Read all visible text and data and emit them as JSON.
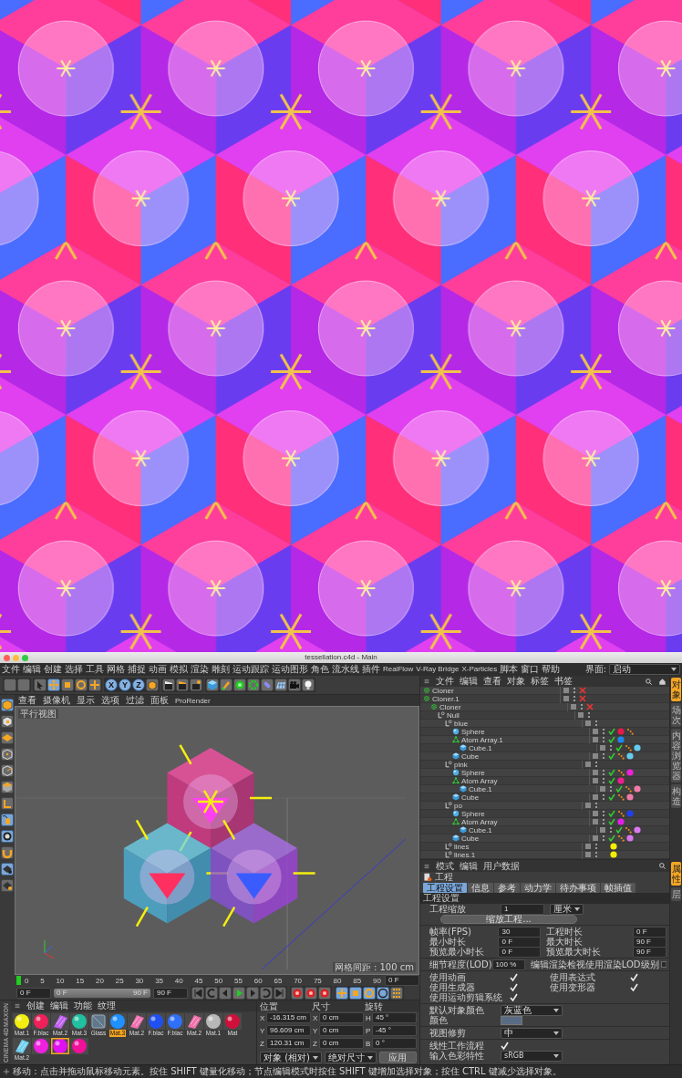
{
  "window": {
    "title": "tessellation.c4d - Main"
  },
  "menu_bar": {
    "items": [
      "文件",
      "编辑",
      "创建",
      "选择",
      "工具",
      "网格",
      "捕捉",
      "动画",
      "模拟",
      "渲染",
      "雕刻",
      "运动跟踪",
      "运动图形",
      "角色",
      "流水线",
      "插件",
      "RealFlow",
      "V-Ray Bridge",
      "X-Particles",
      "脚本",
      "窗口",
      "帮助"
    ],
    "layout_label": "界面:",
    "layout_value": "启动"
  },
  "toolbar": {
    "axis_buttons": [
      "X",
      "Y",
      "Z"
    ]
  },
  "viewport": {
    "menu": [
      "查看",
      "摄像机",
      "显示",
      "选项",
      "过滤",
      "面板",
      "ProRender"
    ],
    "view_name": "平行视图",
    "grid_spacing": "网格间距 : 100 cm"
  },
  "timeline": {
    "ticks": [
      "0",
      "5",
      "10",
      "15",
      "20",
      "25",
      "30",
      "35",
      "40",
      "45",
      "50",
      "55",
      "60",
      "65",
      "70",
      "75",
      "80",
      "85",
      "90"
    ],
    "current_frame": "0 F",
    "start_field": "0 F",
    "range": {
      "level": 1,
      "start": "0 F",
      "end": "90 F"
    },
    "end_field": "90 F"
  },
  "logo": {
    "brand": "MAXON",
    "product": "CINEMA 4D"
  },
  "materials": {
    "menu": [
      "创建",
      "编辑",
      "功能",
      "纹理"
    ],
    "items": [
      {
        "name": "Mat.1",
        "kind": "sphere",
        "color": "#f2ee10",
        "selected": false
      },
      {
        "name": "F.blac",
        "kind": "sphere",
        "color": "#f0205a",
        "selected": false
      },
      {
        "name": "Mat.2",
        "kind": "stripes",
        "color": "#c060f0",
        "selected": false
      },
      {
        "name": "Mat.3",
        "kind": "sphere",
        "color": "#20c0a0",
        "selected": false
      },
      {
        "name": "Glass",
        "kind": "glass",
        "color": "#60788a",
        "selected": false
      },
      {
        "name": "Mat.3",
        "kind": "sphere",
        "color": "#1e90ff",
        "selected": true
      },
      {
        "name": "Mat.2",
        "kind": "stripes",
        "color": "#f070b0",
        "selected": false
      },
      {
        "name": "F.blac",
        "kind": "sphere",
        "color": "#2050f0",
        "selected": false
      },
      {
        "name": "F.blac",
        "kind": "sphere",
        "color": "#3070f8",
        "selected": false
      },
      {
        "name": "Mat.2",
        "kind": "stripes",
        "color": "#f070a8",
        "selected": false
      },
      {
        "name": "Mat.1",
        "kind": "sphere",
        "color": "#b8b8b8",
        "selected": false
      },
      {
        "name": "Mat",
        "kind": "sphere",
        "color": "#d0103a",
        "selected": false
      },
      {
        "name": "Mat.2",
        "kind": "stripes",
        "color": "#70d0f0",
        "selected": false
      },
      {
        "kind": "sphere",
        "color": "#f020e0",
        "selected": false
      },
      {
        "kind": "sphere",
        "color": "#e010f0",
        "selected": true
      },
      {
        "kind": "sphere",
        "color": "#f0109a",
        "selected": false
      }
    ]
  },
  "coordinates": {
    "headers": [
      "位置",
      "尺寸",
      "旋转"
    ],
    "rows": [
      {
        "axis_1": "X",
        "position": "-16.315 cm",
        "axis_2": "X",
        "size": "0 cm",
        "axis_3": "H",
        "rotation": "45 °"
      },
      {
        "axis_1": "Y",
        "position": "96.609 cm",
        "axis_2": "Y",
        "size": "0 cm",
        "axis_3": "P",
        "rotation": "-45 °"
      },
      {
        "axis_1": "Z",
        "position": "120.31 cm",
        "axis_2": "Z",
        "size": "0 cm",
        "axis_3": "B",
        "rotation": "0 °"
      }
    ],
    "mode": "对象 (相对)",
    "size_mode": "绝对尺寸",
    "apply": "应用"
  },
  "object_manager": {
    "menu": [
      "文件",
      "编辑",
      "查看",
      "对象",
      "标签",
      "书签"
    ],
    "tree": [
      {
        "name": "Cloner",
        "kind": "cloner",
        "enabled": false
      },
      {
        "name": "Cloner.1",
        "kind": "cloner",
        "enabled": false,
        "children": [
          {
            "name": "Cloner",
            "kind": "cloner",
            "enabled": false,
            "children": [
              {
                "name": "Null",
                "kind": "null",
                "children": [
                  {
                    "name": "blue",
                    "kind": "null",
                    "children": [
                      {
                        "name": "Sphere",
                        "kind": "sphere",
                        "enabled": true,
                        "tags": [
                          {
                            "kind": "material",
                            "color": "#e8194b"
                          },
                          {
                            "kind": "dots"
                          }
                        ]
                      },
                      {
                        "name": "Atom Array.1",
                        "kind": "atom",
                        "enabled": true,
                        "tags": [
                          {
                            "kind": "material",
                            "color": "#1e88f0"
                          }
                        ],
                        "children": [
                          {
                            "name": "Cube.1",
                            "kind": "cube",
                            "enabled": true,
                            "tags": [
                              {
                                "kind": "dots"
                              },
                              {
                                "kind": "material",
                                "color": "#66ccee"
                              }
                            ]
                          }
                        ]
                      },
                      {
                        "name": "Cube",
                        "kind": "cube",
                        "enabled": true,
                        "tags": [
                          {
                            "kind": "dots"
                          },
                          {
                            "kind": "material",
                            "color": "#66ccee"
                          }
                        ]
                      }
                    ]
                  },
                  {
                    "name": "pink",
                    "kind": "null",
                    "children": [
                      {
                        "name": "Sphere",
                        "kind": "sphere",
                        "enabled": true,
                        "tags": [
                          {
                            "kind": "dots"
                          },
                          {
                            "kind": "material",
                            "color": "#f020d8"
                          }
                        ]
                      },
                      {
                        "name": "Atom Array",
                        "kind": "atom",
                        "enabled": true,
                        "tags": [
                          {
                            "kind": "material",
                            "color": "#f01e90"
                          }
                        ],
                        "children": [
                          {
                            "name": "Cube.1",
                            "kind": "cube",
                            "enabled": true,
                            "tags": [
                              {
                                "kind": "dots"
                              },
                              {
                                "kind": "material",
                                "color": "#f07aa8"
                              }
                            ]
                          }
                        ]
                      },
                      {
                        "name": "Cube",
                        "kind": "cube",
                        "enabled": true,
                        "tags": [
                          {
                            "kind": "dots"
                          },
                          {
                            "kind": "material",
                            "color": "#f07aa8"
                          }
                        ]
                      }
                    ]
                  },
                  {
                    "name": "po",
                    "kind": "null",
                    "children": [
                      {
                        "name": "Sphere",
                        "kind": "sphere",
                        "enabled": true,
                        "tags": [
                          {
                            "kind": "dots"
                          },
                          {
                            "kind": "material",
                            "color": "#2040f0"
                          }
                        ]
                      },
                      {
                        "name": "Atom Array",
                        "kind": "atom",
                        "enabled": true,
                        "tags": [
                          {
                            "kind": "material",
                            "color": "#e020e8"
                          }
                        ],
                        "children": [
                          {
                            "name": "Cube.1",
                            "kind": "cube",
                            "enabled": true,
                            "tags": [
                              {
                                "kind": "dots"
                              },
                              {
                                "kind": "material",
                                "color": "#d878ee"
                              }
                            ]
                          }
                        ]
                      },
                      {
                        "name": "Cube",
                        "kind": "cube",
                        "enabled": true,
                        "tags": [
                          {
                            "kind": "dots"
                          },
                          {
                            "kind": "material",
                            "color": "#d878ee"
                          }
                        ]
                      }
                    ]
                  },
                  {
                    "name": "lines",
                    "kind": "null",
                    "tags": [
                      {
                        "kind": "material",
                        "color": "#f5ee00"
                      }
                    ]
                  },
                  {
                    "name": "lines.1",
                    "kind": "null",
                    "tags": [
                      {
                        "kind": "material",
                        "color": "#f5ee00"
                      }
                    ]
                  }
                ]
              }
            ]
          }
        ]
      }
    ]
  },
  "object_side_tabs": [
    {
      "label": "对象",
      "selected": true
    },
    {
      "label": "场次",
      "selected": false
    },
    {
      "label": "内容浏览器",
      "selected": false
    },
    {
      "label": "构造",
      "selected": false
    }
  ],
  "attributes": {
    "menu": [
      "模式",
      "编辑",
      "用户数据"
    ],
    "title": "工程",
    "tabs": [
      {
        "label": "工程设置",
        "selected": true
      },
      {
        "label": "信息",
        "selected": false
      },
      {
        "label": "参考",
        "selected": false
      },
      {
        "label": "动力学",
        "selected": false
      },
      {
        "label": "待办事项",
        "selected": false
      },
      {
        "label": "帧插值",
        "selected": false
      }
    ],
    "section": "工程设置",
    "scale": {
      "label": "工程缩放",
      "value": "1",
      "unit": "厘米"
    },
    "scale_button": "缩放工程...",
    "time_rows": [
      {
        "label": "帧率(FPS)",
        "value": "30",
        "label_2": "工程时长",
        "value_2": "0 F"
      },
      {
        "label": "最小时长",
        "value": "0 F",
        "label_2": "最大时长",
        "value_2": "90 F"
      },
      {
        "label": "预览最小时长",
        "value": "0 F",
        "label_2": "预览最大时长",
        "value_2": "90 F"
      }
    ],
    "lod": {
      "label": "细节程度(LOD)",
      "value": "100 %",
      "option": "编辑渲染检视使用渲染LOD级别",
      "checked": false
    },
    "checks": [
      {
        "label": "使用动画",
        "checked": true
      },
      {
        "label": "使用表达式",
        "checked": true
      },
      {
        "label": "使用生成器",
        "checked": true
      },
      {
        "label": "使用变形器",
        "checked": true
      },
      {
        "label": "使用运动剪辑系统",
        "checked": true
      }
    ],
    "object_color": {
      "label": "默认对象颜色",
      "value": "灰蓝色"
    },
    "color_label": "颜色",
    "clipping": {
      "label": "视图修剪",
      "value": "中"
    },
    "linear": {
      "label": "线性工作流程",
      "checked": true
    },
    "input_color": {
      "label": "输入色彩特性",
      "value": "sRGB"
    }
  },
  "attribute_side_tabs": [
    {
      "label": "属性",
      "selected": true
    },
    {
      "label": "层",
      "selected": false
    }
  ],
  "status_bar": "移动：点击并拖动鼠标移动元素。按住 SHIFT 键量化移动；节点编辑模式时按住 SHIFT 键增加选择对象；按住 CTRL 键减少选择对象。"
}
